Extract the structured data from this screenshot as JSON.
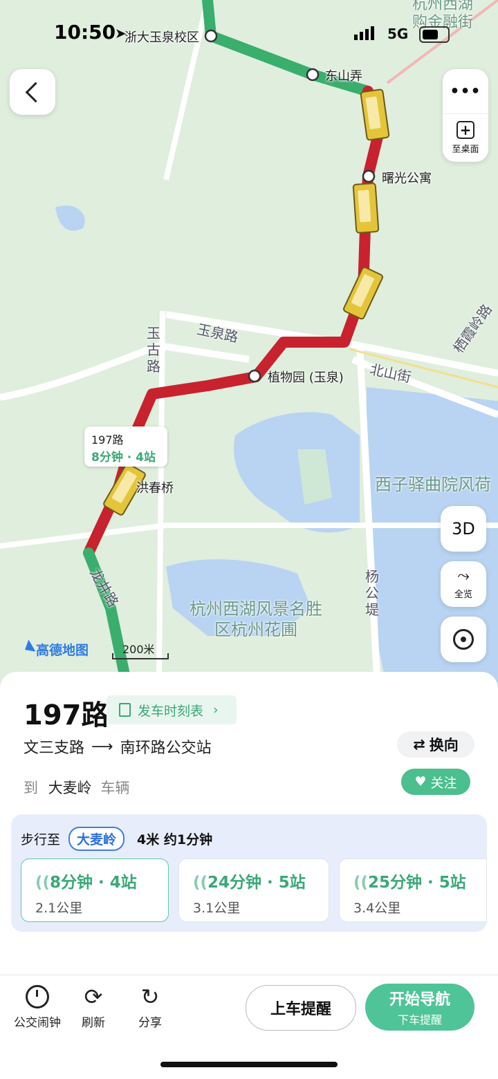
{
  "status_bar": {
    "time": "10:50",
    "network": "5G"
  },
  "map": {
    "stops": [
      "浙大玉泉校区",
      "东山弄",
      "曙光公寓",
      "植物园 (玉泉)",
      "洪春桥"
    ],
    "roads": [
      "玉泉路",
      "玉古路",
      "北山街",
      "龙井路",
      "杨公堤",
      "栖霞岭路"
    ],
    "areas": [
      "杭州西湖风景名胜区杭州花圃",
      "西子驿曲院风荷"
    ],
    "corner_text": [
      "杭州西湖",
      "购金融街"
    ],
    "callout": {
      "route": "197路",
      "eta": "8分钟 · 4站"
    },
    "logo": "高德地图",
    "scale": "200米",
    "buttons": {
      "more": "...",
      "desktop": "至桌面",
      "view3d": "3D",
      "overview": "全览"
    }
  },
  "sheet": {
    "route_name": "197路",
    "timetable_label": "发车时刻表",
    "from": "文三支路",
    "to": "南环路公交站",
    "swap_label": "换向",
    "dest_prefix": "到",
    "dest_stop": "大麦岭",
    "dest_suffix": "车辆",
    "follow_label": "关注",
    "walk": {
      "prefix": "步行至",
      "stop": "大麦岭",
      "info": "4米 约1分钟"
    },
    "etas": [
      {
        "time": "8分钟 · 4站",
        "dist": "2.1公里"
      },
      {
        "time": "24分钟 · 5站",
        "dist": "3.1公里"
      },
      {
        "time": "25分钟 · 5站",
        "dist": "3.4公里"
      }
    ]
  },
  "toolbar": {
    "alarm": "公交闹钟",
    "refresh": "刷新",
    "share": "分享",
    "board_reminder": "上车提醒",
    "start_nav": "开始导航",
    "alight_reminder": "下车提醒"
  },
  "colors": {
    "accent": "#4bbf8e",
    "route_red": "#c8222e",
    "route_green": "#3aae6c",
    "water": "#b9d3f2"
  }
}
